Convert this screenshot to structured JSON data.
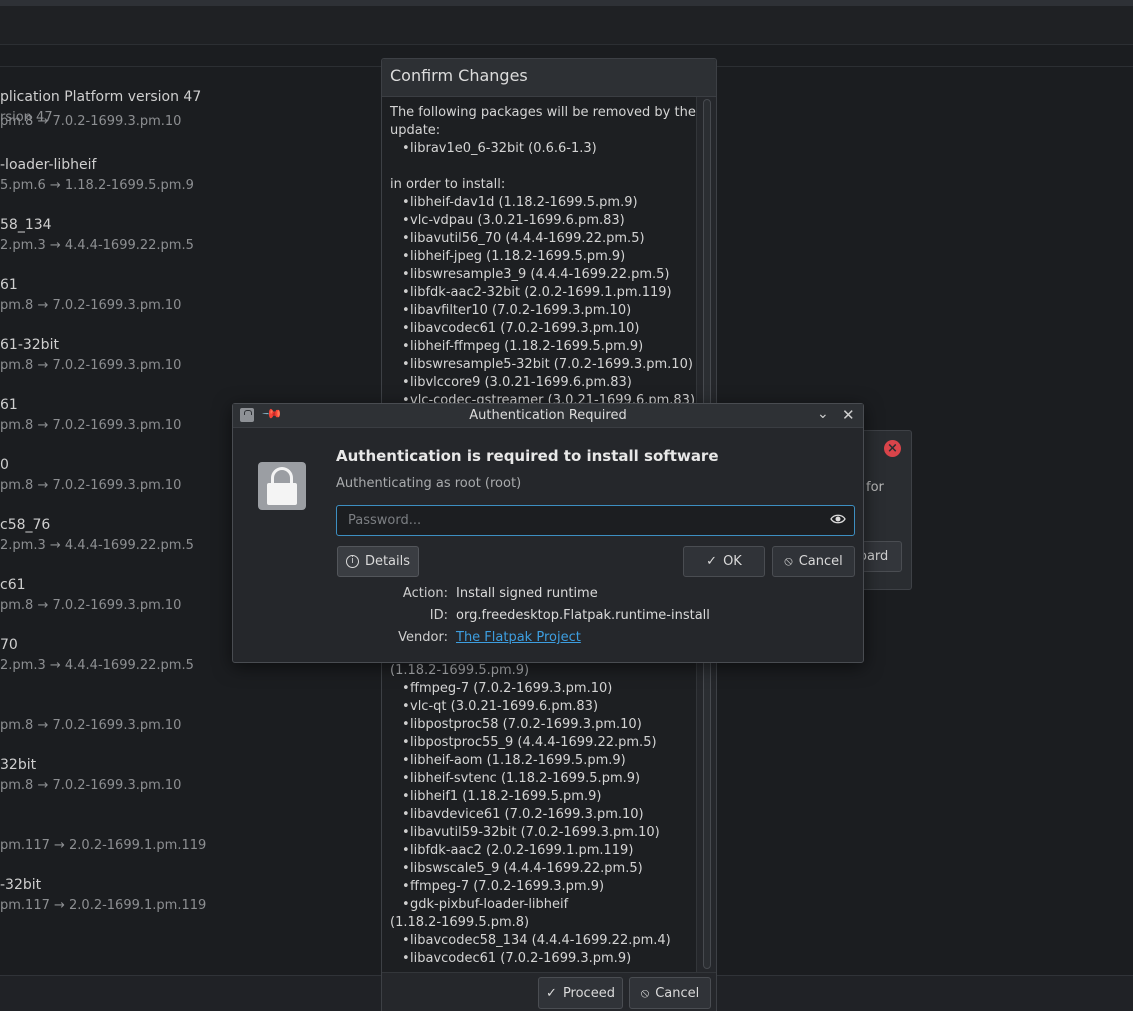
{
  "background": {
    "items": [
      {
        "name": "plication Platform version 47",
        "version": "rsion 47"
      },
      {
        "name": "",
        "version": "pm.8 → 7.0.2-1699.3.pm.10"
      },
      {
        "name": "-loader-libheif",
        "version": "5.pm.6 → 1.18.2-1699.5.pm.9"
      },
      {
        "name": "58_134",
        "version": "2.pm.3 → 4.4.4-1699.22.pm.5"
      },
      {
        "name": "61",
        "version": "pm.8 → 7.0.2-1699.3.pm.10"
      },
      {
        "name": "61-32bit",
        "version": "pm.8 → 7.0.2-1699.3.pm.10"
      },
      {
        "name": "61",
        "version": "pm.8 → 7.0.2-1699.3.pm.10"
      },
      {
        "name": "0",
        "version": "pm.8 → 7.0.2-1699.3.pm.10"
      },
      {
        "name": "c58_76",
        "version": "2.pm.3 → 4.4.4-1699.22.pm.5"
      },
      {
        "name": "c61",
        "version": "pm.8 → 7.0.2-1699.3.pm.10"
      },
      {
        "name": "70",
        "version": "2.pm.3 → 4.4.4-1699.22.pm.5"
      },
      {
        "name": "",
        "version": "pm.8 → 7.0.2-1699.3.pm.10"
      },
      {
        "name": "32bit",
        "version": "pm.8 → 7.0.2-1699.3.pm.10"
      },
      {
        "name": "",
        "version": "pm.117 → 2.0.2-1699.1.pm.119"
      },
      {
        "name": "-32bit",
        "version": "pm.117 → 2.0.2-1699.1.pm.119"
      }
    ]
  },
  "side_dialog": {
    "text": "for",
    "button": "oard"
  },
  "confirm": {
    "title": "Confirm Changes",
    "intro_line1": "The following packages will be removed by the",
    "intro_line2": "update:",
    "removed": [
      "librav1e0_6-32bit (0.6.6-1.3)"
    ],
    "install_intro": "in order to install:",
    "install_top": [
      "libheif-dav1d (1.18.2-1699.5.pm.9)",
      "vlc-vdpau (3.0.21-1699.6.pm.83)",
      "libavutil56_70 (4.4.4-1699.22.pm.5)",
      "libheif-jpeg (1.18.2-1699.5.pm.9)",
      "libswresample3_9 (4.4.4-1699.22.pm.5)",
      "libfdk-aac2-32bit (2.0.2-1699.1.pm.119)",
      "libavfilter10 (7.0.2-1699.3.pm.10)",
      "libavcodec61 (7.0.2-1699.3.pm.10)",
      "libheif-ffmpeg (1.18.2-1699.5.pm.9)",
      "libswresample5-32bit (7.0.2-1699.3.pm.10)",
      "libvlccore9 (3.0.21-1699.6.pm.83)",
      "vlc-codec-gstreamer (3.0.21-1699.6.pm.83)"
    ],
    "continued": "(1.18.2-1699.5.pm.9)",
    "install_bottom": [
      "ffmpeg-7 (7.0.2-1699.3.pm.10)",
      "vlc-qt (3.0.21-1699.6.pm.83)",
      "libpostproc58 (7.0.2-1699.3.pm.10)",
      "libpostproc55_9 (4.4.4-1699.22.pm.5)",
      "libheif-aom (1.18.2-1699.5.pm.9)",
      "libheif-svtenc (1.18.2-1699.5.pm.9)",
      "libheif1 (1.18.2-1699.5.pm.9)",
      "libavdevice61 (7.0.2-1699.3.pm.10)",
      "libavutil59-32bit (7.0.2-1699.3.pm.10)",
      "libfdk-aac2 (2.0.2-1699.1.pm.119)",
      "libswscale5_9 (4.4.4-1699.22.pm.5)",
      "ffmpeg-7 (7.0.2-1699.3.pm.9)",
      "gdk-pixbuf-loader-libheif"
    ],
    "wrap_line": "(1.18.2-1699.5.pm.8)",
    "install_tail": [
      "libavcodec58_134 (4.4.4-1699.22.pm.4)",
      "libavcodec61 (7.0.2-1699.3.pm.9)"
    ],
    "proceed": "Proceed",
    "cancel": "Cancel"
  },
  "auth": {
    "window_title": "Authentication Required",
    "heading": "Authentication is required to install software",
    "subtitle": "Authenticating as root (root)",
    "password_placeholder": "Password...",
    "details": "Details",
    "ok": "OK",
    "cancel": "Cancel",
    "action_label": "Action:",
    "action_value": "Install signed runtime",
    "id_label": "ID:",
    "id_value": "org.freedesktop.Flatpak.runtime-install",
    "vendor_label": "Vendor:",
    "vendor_value": "The Flatpak Project"
  },
  "colors": {
    "background": "#1b1d20",
    "dialog": "#25272b",
    "focus": "#3d8fc2",
    "link": "#3d9ee0",
    "close": "#d9444a"
  }
}
